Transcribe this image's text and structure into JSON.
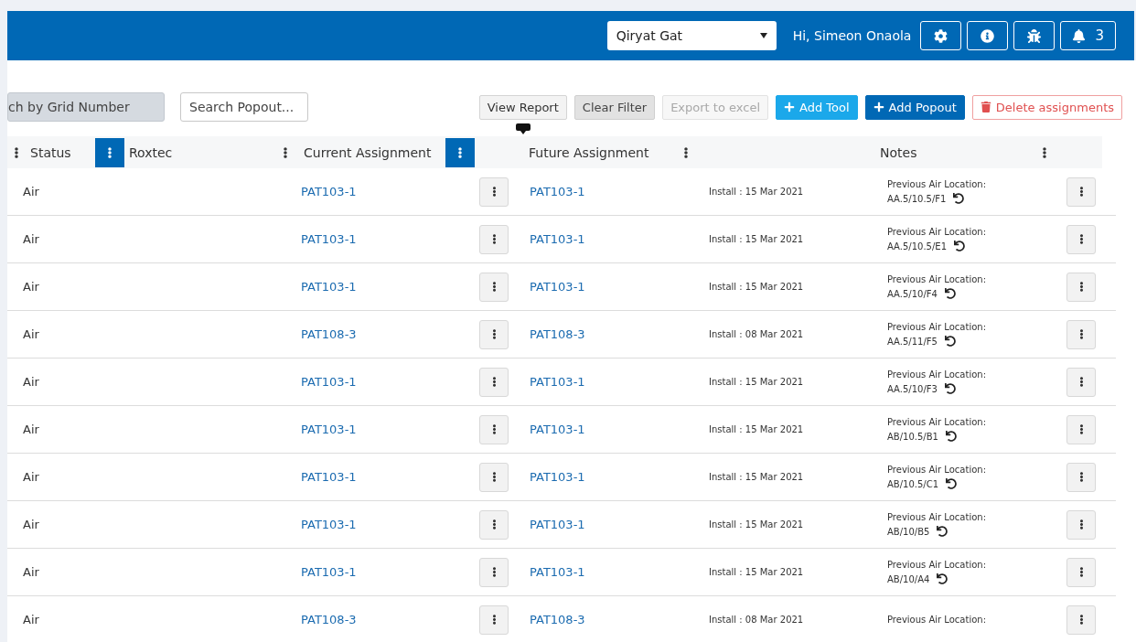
{
  "header": {
    "location_select": {
      "value": "Qiryat Gat"
    },
    "greeting": "Hi, Simeon Onaola",
    "notifications": {
      "count": "3"
    }
  },
  "toolbar": {
    "grid_search": {
      "placeholder": "ch by Grid Number"
    },
    "popout_search": {
      "placeholder": "Search Popout..."
    },
    "buttons": [
      {
        "label": "View Report",
        "kind": "plain",
        "tooltip_pointer": true
      },
      {
        "label": "Clear Filter",
        "kind": "pressed",
        "tooltip_pointer": false
      },
      {
        "label": "Export to excel",
        "kind": "disabled",
        "tooltip_pointer": false
      },
      {
        "label": "Add Tool",
        "kind": "info",
        "tooltip_pointer": false
      },
      {
        "label": "Add Popout",
        "kind": "primary",
        "tooltip_pointer": false
      },
      {
        "label": "Delete assignments",
        "kind": "danger",
        "tooltip_pointer": false
      }
    ]
  },
  "table": {
    "header": [
      {
        "kind": "menu",
        "active": false
      },
      {
        "kind": "label",
        "label": "Status"
      },
      {
        "kind": "menu",
        "active": true
      },
      {
        "kind": "label",
        "label": "Roxtec"
      },
      {
        "kind": "menu",
        "active": false
      },
      {
        "kind": "label",
        "label": "Current Assignment"
      },
      {
        "kind": "menu",
        "active": true
      },
      {
        "kind": "label",
        "label": "Future Assignment"
      },
      {
        "kind": "menu",
        "active": false
      },
      {
        "kind": "label",
        "label": "Notes"
      },
      {
        "kind": "menu",
        "active": false
      }
    ],
    "rows": [
      {
        "status": "Air",
        "current": "PAT103-1",
        "future": "PAT103-1",
        "install": "Install : 15 Mar 2021",
        "note_label": "Previous Air Location:",
        "note_location": "AA.5/10.5/F1"
      },
      {
        "status": "Air",
        "current": "PAT103-1",
        "future": "PAT103-1",
        "install": "Install : 15 Mar 2021",
        "note_label": "Previous Air Location:",
        "note_location": "AA.5/10.5/E1"
      },
      {
        "status": "Air",
        "current": "PAT103-1",
        "future": "PAT103-1",
        "install": "Install : 15 Mar 2021",
        "note_label": "Previous Air Location:",
        "note_location": "AA.5/10/F4"
      },
      {
        "status": "Air",
        "current": "PAT108-3",
        "future": "PAT108-3",
        "install": "Install : 08 Mar 2021",
        "note_label": "Previous Air Location:",
        "note_location": "AA.5/11/F5"
      },
      {
        "status": "Air",
        "current": "PAT103-1",
        "future": "PAT103-1",
        "install": "Install : 15 Mar 2021",
        "note_label": "Previous Air Location:",
        "note_location": "AA.5/10/F3"
      },
      {
        "status": "Air",
        "current": "PAT103-1",
        "future": "PAT103-1",
        "install": "Install : 15 Mar 2021",
        "note_label": "Previous Air Location:",
        "note_location": "AB/10.5/B1"
      },
      {
        "status": "Air",
        "current": "PAT103-1",
        "future": "PAT103-1",
        "install": "Install : 15 Mar 2021",
        "note_label": "Previous Air Location:",
        "note_location": "AB/10.5/C1"
      },
      {
        "status": "Air",
        "current": "PAT103-1",
        "future": "PAT103-1",
        "install": "Install : 15 Mar 2021",
        "note_label": "Previous Air Location:",
        "note_location": "AB/10/B5"
      },
      {
        "status": "Air",
        "current": "PAT103-1",
        "future": "PAT103-1",
        "install": "Install : 15 Mar 2021",
        "note_label": "Previous Air Location:",
        "note_location": "AB/10/A4"
      },
      {
        "status": "Air",
        "current": "PAT108-3",
        "future": "PAT108-3",
        "install": "Install : 08 Mar 2021",
        "note_label": "Previous Air Location:"
      }
    ]
  }
}
